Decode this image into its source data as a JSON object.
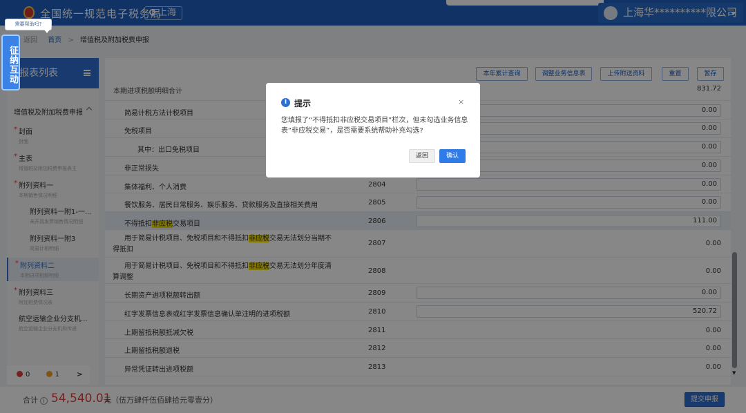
{
  "header": {
    "site_title": "全国统一规范电子税务局",
    "region": "上海",
    "user_name": "上海华**********限公司"
  },
  "help": {
    "tooltip": "需要帮助吗?",
    "float_tab": "征纳互动"
  },
  "breadcrumb": {
    "back": "返回",
    "home": "首页",
    "separator": ">",
    "current": "增值税及附加税费申报"
  },
  "sidebar": {
    "title": "报表列表",
    "group": "增值税及附加税费申报",
    "items": [
      {
        "title": "封面",
        "subtitle": "封面",
        "required": "*"
      },
      {
        "title": "主表",
        "subtitle": "增值税及附加税费申报表主",
        "required": "*"
      },
      {
        "title": "附列资料一",
        "subtitle": "本期销售情况明细",
        "required": "*"
      },
      {
        "title": "附列资料一附1-一...",
        "subtitle": "未开具发票销售情况明细"
      },
      {
        "title": "附列资料一附3",
        "subtitle": "简易计税明细"
      },
      {
        "title": "附列资料二",
        "subtitle": "本期进项税额明细",
        "required": "*"
      },
      {
        "title": "附列资料三",
        "subtitle": "附加税费情况表",
        "required": "*"
      },
      {
        "title": "航空运输企业分支机...",
        "subtitle": "航空运输企业分支机构传递"
      }
    ],
    "status": {
      "errors": "0",
      "warnings": "1",
      "next": ">"
    }
  },
  "toolbar": {
    "buttons": [
      "本年累计查询",
      "调整业务信息表",
      "上传附送资料",
      "重置",
      "暂存"
    ]
  },
  "form": {
    "partial_row": {
      "label": "本期进项税额明细合计",
      "value": "831.72"
    },
    "rows": [
      {
        "label": "简易计税方法计税项目",
        "code": "",
        "value": "0.00"
      },
      {
        "label": "免税项目",
        "code": "",
        "value": "0.00"
      },
      {
        "label": "其中：出口免税项目",
        "code": "",
        "value": "0.00"
      },
      {
        "label": "非正常损失",
        "code": "",
        "value": "0.00"
      },
      {
        "label": "集体福利、个人消费",
        "code": "2804",
        "value": "0.00"
      },
      {
        "label": "餐饮服务、居民日常服务、娱乐服务、贷款服务及直接相关费用",
        "code": "2805",
        "value": "0.00"
      },
      {
        "label_pre": "不得抵扣",
        "label_hl": "非应税",
        "label_post": "交易项目",
        "code": "2806",
        "value": "111.00"
      },
      {
        "label_pre": "用于简易计税项目、免税项目和不得抵扣",
        "label_hl": "非应税",
        "label_post": "交易无法划分当期不得抵扣",
        "code": "2807",
        "value": "0.00"
      },
      {
        "label_pre": "用于简易计税项目、免税项目和不得抵扣",
        "label_hl": "非应税",
        "label_post": "交易无法划分年度清算调整",
        "code": "2808",
        "value": "0.00"
      },
      {
        "label": "长期资产进项税额转出额",
        "code": "2809",
        "value": "0.00"
      },
      {
        "label": "红字发票信息表或红字发票信息确认单注明的进项税额",
        "code": "2810",
        "value": "520.72"
      },
      {
        "label": "上期留抵税额抵减欠税",
        "code": "2811",
        "value": "0.00"
      },
      {
        "label": "上期留抵税额退税",
        "code": "2812",
        "value": "0.00"
      },
      {
        "label": "异常凭证转出进项税额",
        "code": "2813",
        "value": "0.00"
      }
    ]
  },
  "footer": {
    "total_label": "合计",
    "info_glyph": "i",
    "amount": "54,540.01",
    "unit_text": "元（伍万肆仟伍佰肆拾元零壹分）",
    "submit": "提交申报"
  },
  "modal": {
    "title": "提示",
    "message": "您填报了“不得抵扣非应税交易项目”栏次，但未勾选业务信息表“非应税交易”，是否需要系统帮助补充勾选?",
    "cancel": "返回",
    "confirm": "确认",
    "close": "×",
    "icon": "i"
  },
  "colors": {
    "header_blue": "#1f5fbf",
    "primary": "#2f6fd1",
    "amount_red": "#e23c3c",
    "highlight": "#f5e000"
  }
}
